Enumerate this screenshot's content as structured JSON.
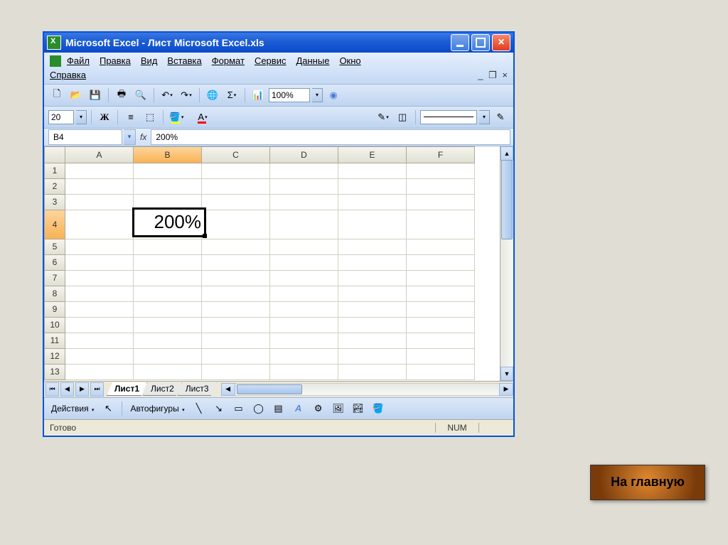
{
  "window": {
    "title": "Microsoft Excel - Лист Microsoft Excel.xls"
  },
  "menu": {
    "file": "Файл",
    "edit": "Правка",
    "view": "Вид",
    "insert": "Вставка",
    "format": "Формат",
    "tools": "Сервис",
    "data": "Данные",
    "window": "Окно",
    "help": "Справка"
  },
  "toolbar": {
    "zoom": "100%",
    "fontsize": "20"
  },
  "formula": {
    "namebox": "B4",
    "fx": "fx",
    "value": "200%"
  },
  "columns": [
    "A",
    "B",
    "C",
    "D",
    "E",
    "F"
  ],
  "rows": [
    "1",
    "2",
    "3",
    "4",
    "5",
    "6",
    "7",
    "8",
    "9",
    "10",
    "11",
    "12",
    "13"
  ],
  "activeCell": {
    "value": "200%"
  },
  "tabs": {
    "t1": "Лист1",
    "t2": "Лист2",
    "t3": "Лист3"
  },
  "draw": {
    "actions": "Действия",
    "autoshapes": "Автофигуры"
  },
  "status": {
    "ready": "Готово",
    "num": "NUM"
  },
  "home": {
    "label": "На главную"
  }
}
